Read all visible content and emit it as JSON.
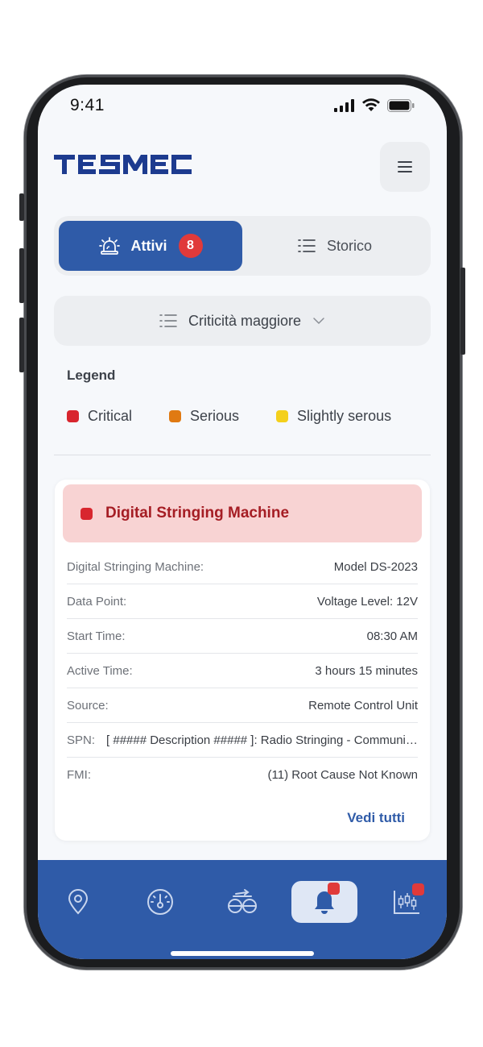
{
  "status_bar": {
    "time": "9:41"
  },
  "header": {
    "logo_text": "TESMEC"
  },
  "tabs": [
    {
      "label": "Attivi",
      "badge": "8",
      "active": true
    },
    {
      "label": "Storico",
      "active": false
    }
  ],
  "sort": {
    "label": "Criticità maggiore"
  },
  "legend": {
    "title": "Legend",
    "items": [
      {
        "label": "Critical",
        "color": "#d8262e"
      },
      {
        "label": "Serious",
        "color": "#e07a12"
      },
      {
        "label": "Slightly serous",
        "color": "#f4d01c"
      }
    ]
  },
  "alert_card": {
    "title": "Digital Stringing Machine",
    "severity_color": "#d8262e",
    "rows": [
      {
        "key": "Digital Stringing Machine:",
        "value": "Model DS-2023"
      },
      {
        "key": "Data Point:",
        "value": "Voltage Level: 12V"
      },
      {
        "key": "Start Time:",
        "value": "08:30 AM"
      },
      {
        "key": "Active Time:",
        "value": "3 hours 15 minutes"
      },
      {
        "key": "Source:",
        "value": "Remote Control Unit"
      },
      {
        "key": "SPN:",
        "value": "[ ##### Description ##### ]: Radio Stringing - Communication"
      },
      {
        "key": "FMI:",
        "value": "(11) Root Cause Not Known"
      }
    ],
    "see_all": "Vedi tutti"
  },
  "bottom_nav": {
    "items": [
      {
        "icon": "location-pin-icon"
      },
      {
        "icon": "dashboard-gauge-icon"
      },
      {
        "icon": "stringing-machine-icon"
      },
      {
        "icon": "bell-icon",
        "active": true,
        "has_notification": true
      },
      {
        "icon": "analytics-chart-icon",
        "has_notification": true
      }
    ]
  },
  "colors": {
    "primary": "#2f5ba8",
    "badge": "#e03a3a",
    "critical_bg": "#f8d3d3"
  }
}
